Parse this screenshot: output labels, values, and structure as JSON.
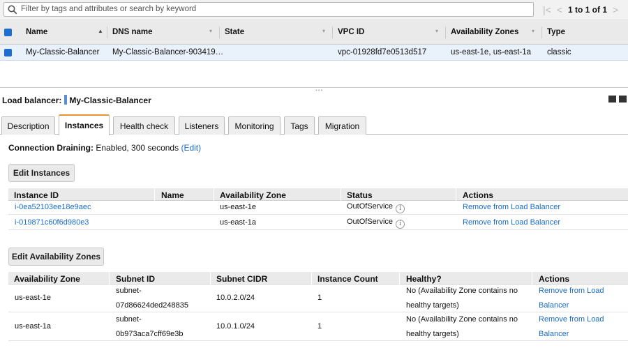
{
  "search": {
    "placeholder": "Filter by tags and attributes or search by keyword"
  },
  "pager": {
    "first": "|<",
    "prev": "<",
    "text": "1 to 1 of 1",
    "next": ">"
  },
  "lb_table": {
    "headers": [
      "Name",
      "DNS name",
      "State",
      "VPC ID",
      "Availability Zones",
      "Type"
    ],
    "sort_icon": "▲",
    "dropdown_icon": "▾",
    "row": {
      "name": "My-Classic-Balancer",
      "dns": "My-Classic-Balancer-903419…",
      "state": "",
      "vpc": "vpc-01928fd7e0513d517",
      "azs": "us-east-1e, us-east-1a",
      "type": "classic"
    }
  },
  "divider_dots": "•••",
  "detail": {
    "label": "Load balancer:",
    "name": "My-Classic-Balancer"
  },
  "tabs": [
    "Description",
    "Instances",
    "Health check",
    "Listeners",
    "Monitoring",
    "Tags",
    "Migration"
  ],
  "active_tab": "Instances",
  "draining": {
    "label": "Connection Draining:",
    "value": "Enabled, 300 seconds",
    "edit": "(Edit)"
  },
  "edit_instances_label": "Edit Instances",
  "instances": {
    "headers": [
      "Instance ID",
      "Name",
      "Availability Zone",
      "Status",
      "Actions"
    ],
    "rows": [
      {
        "id": "i-0ea52103ee18e9aec",
        "name": "",
        "az": "us-east-1e",
        "status": "OutOfService",
        "action": "Remove from Load Balancer"
      },
      {
        "id": "i-019871c60f6d980e3",
        "name": "",
        "az": "us-east-1a",
        "status": "OutOfService",
        "action": "Remove from Load Balancer"
      }
    ]
  },
  "info_icon": "i",
  "edit_az_label": "Edit Availability Zones",
  "zones": {
    "headers": [
      "Availability Zone",
      "Subnet ID",
      "Subnet CIDR",
      "Instance Count",
      "Healthy?",
      "Actions"
    ],
    "rows": [
      {
        "az": "us-east-1e",
        "subnet_1": "subnet-",
        "subnet_2": "07d86624ded248835",
        "cidr": "10.0.2.0/24",
        "count": "1",
        "healthy_1": "No (Availability Zone contains no",
        "healthy_2": "healthy targets)",
        "action_1": "Remove from Load",
        "action_2": "Balancer"
      },
      {
        "az": "us-east-1a",
        "subnet_1": "subnet-",
        "subnet_2": "0b973aca7cff69e3b",
        "cidr": "10.0.1.0/24",
        "count": "1",
        "healthy_1": "No (Availability Zone contains no",
        "healthy_2": "healthy targets)",
        "action_1": "Remove from Load",
        "action_2": "Balancer"
      }
    ]
  },
  "colors": {
    "accent": "#1c6fd1",
    "link": "#1a6cc4",
    "tab_active": "#e8932c",
    "selected_row": "#e9f1fb"
  }
}
